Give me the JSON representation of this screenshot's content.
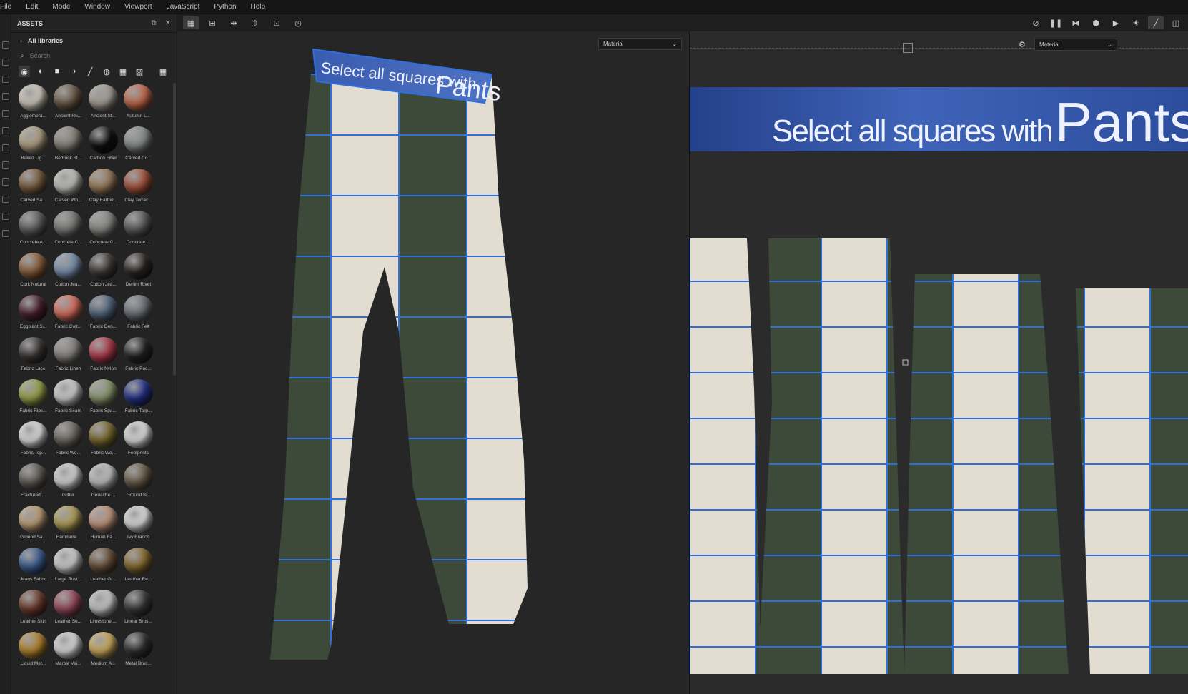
{
  "menu": [
    "File",
    "Edit",
    "Mode",
    "Window",
    "Viewport",
    "JavaScript",
    "Python",
    "Help"
  ],
  "assets": {
    "title": "ASSETS",
    "library": "All libraries",
    "search_placeholder": "Search",
    "materials": [
      {
        "name": "Agglomera...",
        "color": "#d8d2c4"
      },
      {
        "name": "Ancient Ru...",
        "color": "#6b5a45"
      },
      {
        "name": "Ancient St...",
        "color": "#a9a39a"
      },
      {
        "name": "Autumn L...",
        "color": "#c76b4a"
      },
      {
        "name": "Baked Lig...",
        "color": "#b7a688"
      },
      {
        "name": "Bedrock St...",
        "color": "#8b857a"
      },
      {
        "name": "Carbon Fiber",
        "color": "#0e0e0e"
      },
      {
        "name": "Carved Co...",
        "color": "#8c8f8e"
      },
      {
        "name": "Carved Sa...",
        "color": "#7a5c3d"
      },
      {
        "name": "Carved Wh...",
        "color": "#c9c9c4"
      },
      {
        "name": "Clay Earthe...",
        "color": "#9c7b5a"
      },
      {
        "name": "Clay Terrac...",
        "color": "#a6513a"
      },
      {
        "name": "Concrete A...",
        "color": "#5f5f5f"
      },
      {
        "name": "Concrete C...",
        "color": "#7b7b78"
      },
      {
        "name": "Concrete C...",
        "color": "#8a8a86"
      },
      {
        "name": "Concrete ...",
        "color": "#5b5b5b"
      },
      {
        "name": "Cork Natural",
        "color": "#8d5f3b"
      },
      {
        "name": "Cotton Jea...",
        "color": "#7d94b3"
      },
      {
        "name": "Cotton Jea...",
        "color": "#3e3a37"
      },
      {
        "name": "Denim Rivet",
        "color": "#2a2420"
      },
      {
        "name": "Eggplant S...",
        "color": "#4a1f2c"
      },
      {
        "name": "Fabric Cott...",
        "color": "#e0705f"
      },
      {
        "name": "Fabric Den...",
        "color": "#52677f"
      },
      {
        "name": "Fabric Felt",
        "color": "#6e757c"
      },
      {
        "name": "Fabric Lace",
        "color": "#3a3533"
      },
      {
        "name": "Fabric Linen",
        "color": "#8a8782"
      },
      {
        "name": "Fabric Nylon",
        "color": "#b23a4a"
      },
      {
        "name": "Fabric Puc...",
        "color": "#232323"
      },
      {
        "name": "Fabric Rips...",
        "color": "#9aa54a"
      },
      {
        "name": "Fabric Seam",
        "color": "#d7d7d7"
      },
      {
        "name": "Fabric Spa...",
        "color": "#8e9a70"
      },
      {
        "name": "Fabric Tarp...",
        "color": "#23318a"
      },
      {
        "name": "Fabric Top...",
        "color": "#e6e6e6"
      },
      {
        "name": "Fabric Wo...",
        "color": "#6f6a61"
      },
      {
        "name": "Fabric Wo...",
        "color": "#7b6a2c"
      },
      {
        "name": "Footprints",
        "color": "#e8e8e8"
      },
      {
        "name": "Fractured ...",
        "color": "#605c55"
      },
      {
        "name": "Glitter",
        "color": "#dedede"
      },
      {
        "name": "Gouache ...",
        "color": "#c8c8c8"
      },
      {
        "name": "Ground N...",
        "color": "#6b5d4a"
      },
      {
        "name": "Ground Sa...",
        "color": "#c2a27a"
      },
      {
        "name": "Hammere...",
        "color": "#b6a35a"
      },
      {
        "name": "Human Fa...",
        "color": "#c89a82"
      },
      {
        "name": "Ivy Branch",
        "color": "#e7e7e7"
      },
      {
        "name": "Jeans Fabric",
        "color": "#3b5e91"
      },
      {
        "name": "Large Rust...",
        "color": "#d8d8d8"
      },
      {
        "name": "Leather Gr...",
        "color": "#6a5038"
      },
      {
        "name": "Leather Re...",
        "color": "#8a6c2e"
      },
      {
        "name": "Leather Skin",
        "color": "#6e3a2c"
      },
      {
        "name": "Leather Su...",
        "color": "#9a4a5c"
      },
      {
        "name": "Limestone ...",
        "color": "#cfcfcf"
      },
      {
        "name": "Linear Brus...",
        "color": "#3a3a3a"
      },
      {
        "name": "Liquid Met...",
        "color": "#b8862c"
      },
      {
        "name": "Marble Vei...",
        "color": "#e3e3e3"
      },
      {
        "name": "Medium A...",
        "color": "#d4b060"
      },
      {
        "name": "Metal Brus...",
        "color": "#2f2f2f"
      }
    ]
  },
  "viewport3d": {
    "material_dropdown": "Material",
    "banner_small": "Select all squares with",
    "banner_big": "Pants"
  },
  "viewport2d": {
    "material_dropdown": "Material",
    "banner_small": "Select all squares with",
    "banner_big": "Pants"
  },
  "accent": "#2f6fdc"
}
